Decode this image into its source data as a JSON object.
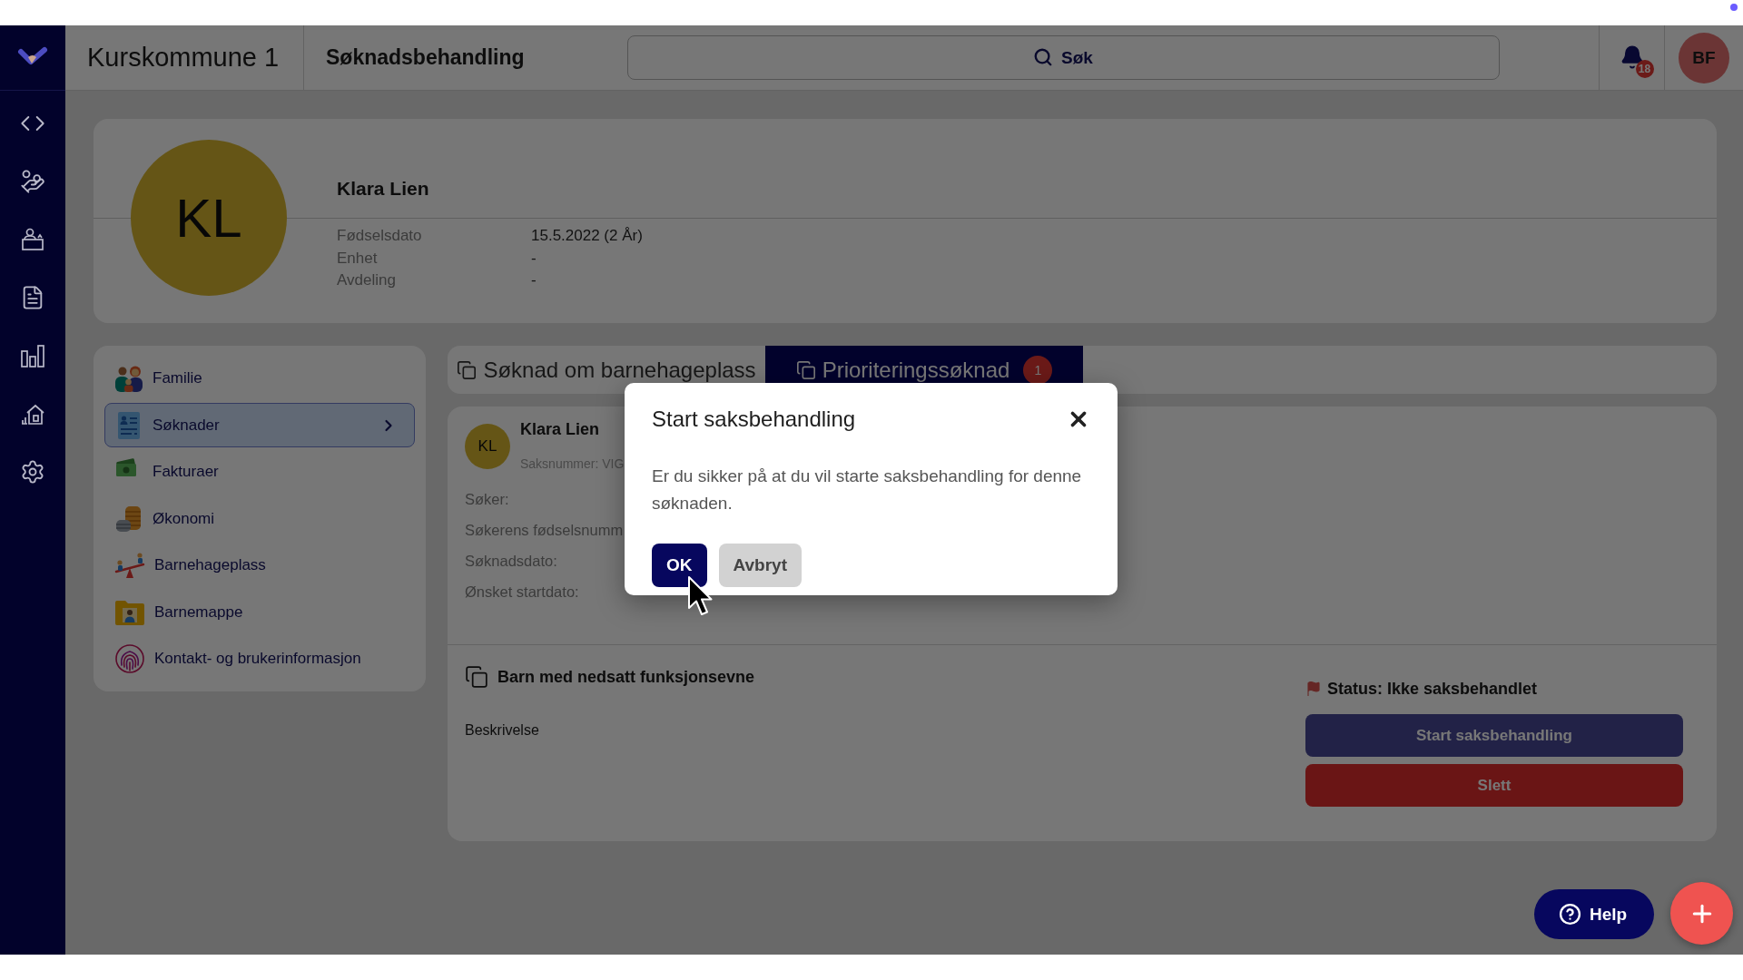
{
  "header": {
    "organization": "Kurskommune 1",
    "page_title": "Søknadsbehandling",
    "search": {
      "placeholder": "Søk"
    },
    "notification_count": "18",
    "user_initials": "BF"
  },
  "profile": {
    "initials": "KL",
    "name": "Klara Lien",
    "fields": [
      {
        "label": "Fødselsdato",
        "value": "15.5.2022 (2 År)"
      },
      {
        "label": "Enhet",
        "value": "-"
      },
      {
        "label": "Avdeling",
        "value": "-"
      }
    ]
  },
  "menu": {
    "items": [
      {
        "label": "Familie",
        "selected": false
      },
      {
        "label": "Søknader",
        "selected": true
      },
      {
        "label": "Fakturaer",
        "selected": false
      },
      {
        "label": "Økonomi",
        "selected": false
      },
      {
        "label": "Barnehageplass",
        "selected": false
      },
      {
        "label": "Barnemappe",
        "selected": false
      },
      {
        "label": "Kontakt- og brukerinformasjon",
        "selected": false
      }
    ]
  },
  "application_tabs": [
    {
      "label": "Søknad om barnehageplass",
      "selected": false
    },
    {
      "label": "Prioriteringssøknad",
      "selected": true,
      "badge": "1"
    }
  ],
  "application": {
    "initials": "KL",
    "name": "Klara Lien",
    "case_number": "Saksnummer: VIG",
    "fields": [
      "Søker:",
      "Søkerens fødselsnumm",
      "Søknadsdato:",
      "Ønsket startdato:"
    ],
    "section_title": "Barn med nedsatt funksjonsevne",
    "description_label": "Beskrivelse",
    "status": "Status: Ikke saksbehandlet",
    "actions": [
      {
        "label": "Start saksbehandling",
        "kind": "primary"
      },
      {
        "label": "Slett",
        "kind": "danger"
      }
    ]
  },
  "help_button": {
    "label": "Help"
  },
  "dialog": {
    "title": "Start saksbehandling",
    "message": "Er du sikker på at du vil starte saksbehandling for denne søknaden.",
    "buttons": [
      {
        "label": "OK",
        "kind": "primary"
      },
      {
        "label": "Avbryt",
        "kind": "secondary"
      }
    ]
  }
}
